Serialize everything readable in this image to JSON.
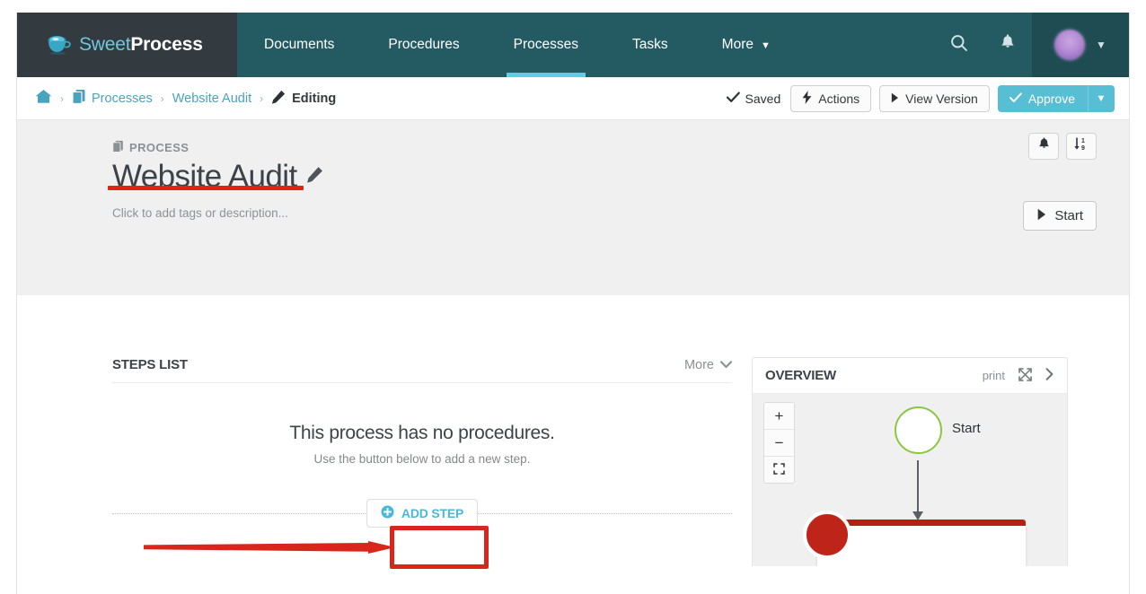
{
  "app": {
    "brand_sweet": "Sweet",
    "brand_process": "Process"
  },
  "navbar": {
    "items": [
      {
        "label": "Documents",
        "active": false
      },
      {
        "label": "Procedures",
        "active": false
      },
      {
        "label": "Processes",
        "active": true
      },
      {
        "label": "Tasks",
        "active": false
      },
      {
        "label": "More",
        "active": false,
        "has_caret": true
      }
    ],
    "more_label": "More",
    "search_icon": "search-icon",
    "bell_icon": "bell-icon",
    "avatar_caret": "chevron-down-icon"
  },
  "breadcrumb": {
    "home": "home-icon",
    "sep": "›",
    "processes": "Processes",
    "website_audit": "Website Audit",
    "editing": "Editing"
  },
  "toolbar": {
    "saved_label": "Saved",
    "actions_label": "Actions",
    "view_version_label": "View Version",
    "approve_label": "Approve",
    "approve_caret": "caret-down-icon"
  },
  "doc": {
    "kicker": "PROCESS",
    "title": "Website Audit",
    "subtitle": "Click to add tags or description...",
    "bell_button": "bell-icon",
    "sort_button": "sort-numeric-icon",
    "start_label": "Start"
  },
  "steps": {
    "panel_title": "STEPS LIST",
    "more_label": "More",
    "empty_title": "This process has no procedures.",
    "empty_subtitle": "Use the button below to add a new step.",
    "add_step_label": "ADD STEP"
  },
  "overview": {
    "panel_title": "OVERVIEW",
    "print_label": "print",
    "expand_icon": "expand-icon",
    "collapse_icon": "chevron-right-icon",
    "zoom_in": "+",
    "zoom_out": "−",
    "zoom_fit": "fit-icon",
    "start_node_label": "Start"
  },
  "annotations": {
    "title_underline_color": "#e02318",
    "add_step_box_color": "#d9261c",
    "arrow_color": "#d9261c",
    "overview_dot_color": "#bf2418"
  },
  "colors": {
    "navbar_bg": "#245b63",
    "brand_bg": "#333b40",
    "active_tab": "#63cbe3",
    "link": "#4aa3bd",
    "primary_button": "#57bed4",
    "header_band": "#f0f0f0",
    "start_node_border": "#8cc63f"
  }
}
